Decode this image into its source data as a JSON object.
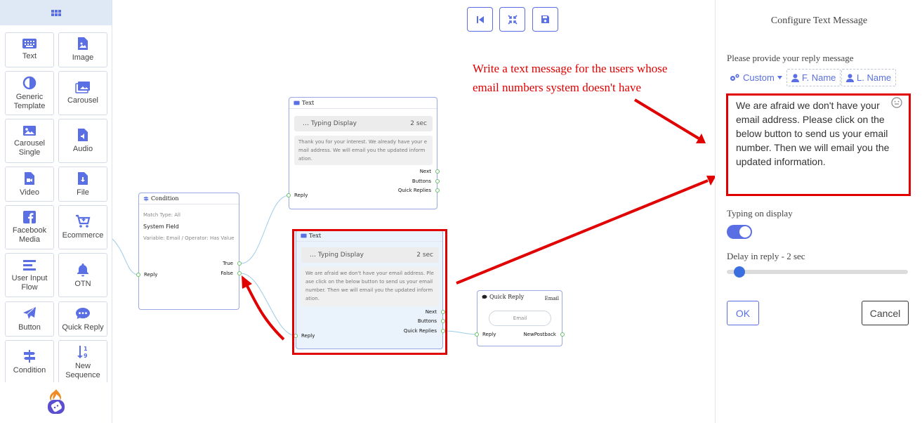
{
  "sidebar": {
    "tiles": [
      {
        "label": "Text",
        "icon": "keyboard-icon"
      },
      {
        "label": "Image",
        "icon": "image-file-icon"
      },
      {
        "label": "Generic Template",
        "icon": "half-circle-icon"
      },
      {
        "label": "Carousel",
        "icon": "images-icon"
      },
      {
        "label": "Carousel Single",
        "icon": "image-icon"
      },
      {
        "label": "Audio",
        "icon": "audio-file-icon"
      },
      {
        "label": "Video",
        "icon": "video-file-icon"
      },
      {
        "label": "File",
        "icon": "download-file-icon"
      },
      {
        "label": "Facebook Media",
        "icon": "facebook-icon"
      },
      {
        "label": "Ecommerce",
        "icon": "cart-plus-icon"
      },
      {
        "label": "User Input Flow",
        "icon": "lines-icon"
      },
      {
        "label": "OTN",
        "icon": "bell-icon"
      },
      {
        "label": "Button",
        "icon": "paper-plane-icon"
      },
      {
        "label": "Quick Reply",
        "icon": "comment-dots-icon"
      },
      {
        "label": "Condition",
        "icon": "signs-icon"
      },
      {
        "label": "New Sequence",
        "icon": "sort-numeric-icon"
      }
    ]
  },
  "nodes": {
    "condition": {
      "title": "Condition",
      "match_type": "Match Type: All",
      "field": "System Field",
      "variable": "Variable: Email / Operator: Has Value",
      "true_label": "True",
      "false_label": "False",
      "reply_label": "Reply"
    },
    "text_top": {
      "title": "Text",
      "typing": "Typing Display",
      "typing_time": "2 sec",
      "message": "Thank you for your interest. We already have your e mail address. We will email you the updated inform ation.",
      "next": "Next",
      "buttons": "Buttons",
      "quick_replies": "Quick Replies",
      "reply": "Reply"
    },
    "text_bottom": {
      "title": "Text",
      "typing": "Typing Display",
      "typing_time": "2 sec",
      "message": "We are afraid we don't have your email address. Ple ase click on the below button to send us your email number. Then we will email you the updated inform ation.",
      "next": "Next",
      "buttons": "Buttons",
      "quick_replies": "Quick Replies",
      "reply": "Reply"
    },
    "quick_reply": {
      "title": "Quick Reply",
      "tag": "Email",
      "button": "Email",
      "reply": "Reply",
      "postback": "NewPostback"
    }
  },
  "annotation": {
    "line1": "Write a text message for the users whose",
    "line2": "email numbers system doesn't have"
  },
  "panel": {
    "title": "Configure Text Message",
    "reply_label": "Please provide your reply message",
    "custom": "Custom",
    "first_name": "F. Name",
    "last_name": "L. Name",
    "reply_text": "We are afraid we don't have your email address. Please click on the below button to send us your email number. Then we will email you the updated information.",
    "typing_label": "Typing on display",
    "delay_label": "Delay in reply  -  2 sec",
    "delay_fraction": 0.04,
    "ok": "OK",
    "cancel": "Cancel"
  },
  "colors": {
    "accent": "#5a6fe3",
    "annotation_red": "#e00000",
    "connector_green": "#6abf6a"
  }
}
